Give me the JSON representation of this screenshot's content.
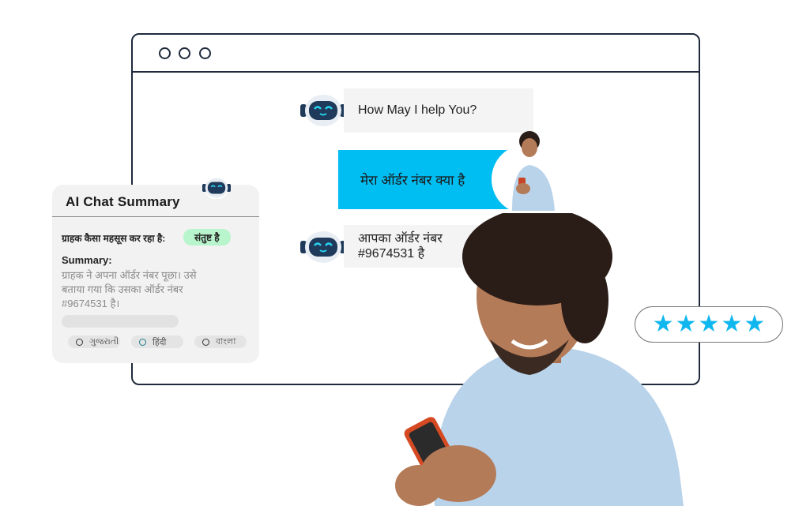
{
  "chat": {
    "bot_greeting": "How May I help You?",
    "user_message": "मेरा ऑर्डर नंबर क्या है",
    "bot_reply_line1": "आपका ऑर्डर नंबर",
    "bot_reply_line2": "#9674531 है"
  },
  "summary": {
    "title": "AI Chat Summary",
    "feeling_label": "ग्राहक कैसा महसूस कर रहा है:",
    "feeling_value": "संतुष्ट है",
    "heading": "Summary:",
    "body_line1": "ग्राहक ने अपना ऑर्डर नंबर पूछा। उसे",
    "body_line2": "बताया गया कि उसका ऑर्डर नंबर",
    "body_line3": "#9674531 है।",
    "languages": [
      "ગુજરાતી",
      "हिंदी",
      "বাংলা"
    ],
    "selected_language": "हिंदी"
  },
  "rating": {
    "stars": 5,
    "max": 5,
    "color": "#10b7ef"
  },
  "colors": {
    "accent": "#00bdf2",
    "frame": "#1f2a3c",
    "badge": "#b8f5cc"
  }
}
